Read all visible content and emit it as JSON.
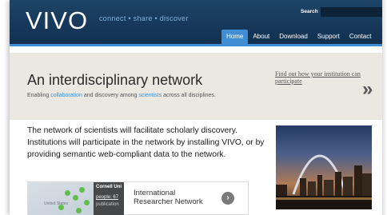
{
  "header": {
    "logo": "VIVO",
    "tagline": "connect  •  share  •  discover",
    "search_label": "Search",
    "search_value": "",
    "nav": [
      {
        "label": "Home",
        "active": true
      },
      {
        "label": "About",
        "active": false
      },
      {
        "label": "Download",
        "active": false
      },
      {
        "label": "Support",
        "active": false
      },
      {
        "label": "Contact",
        "active": false
      }
    ]
  },
  "banner": {
    "title": "An interdisciplinary network",
    "sub_before": "Enabling ",
    "sub_link1": "collaboration",
    "sub_middle": " and discovery among ",
    "sub_link2": "scientists",
    "sub_after": " across all disciplines.",
    "side_link": "Find out how your institution can participate",
    "arrow": "»"
  },
  "main": {
    "intro": "The network of scientists will facilitate scholarly discovery. Institutions will participate in the network by installing VIVO, or by providing semantic web-compliant data to the network.",
    "map_card": {
      "overlay_title": "Cornell Uni",
      "overlay_people": "people: 67",
      "overlay_pubs": "publication",
      "map_label": "United States",
      "title": "International Researcher Network",
      "arrow": "›"
    }
  },
  "colors": {
    "header_bg": "#16385a",
    "accent": "#3f8ed4",
    "banner_bg": "#eae8e1"
  }
}
